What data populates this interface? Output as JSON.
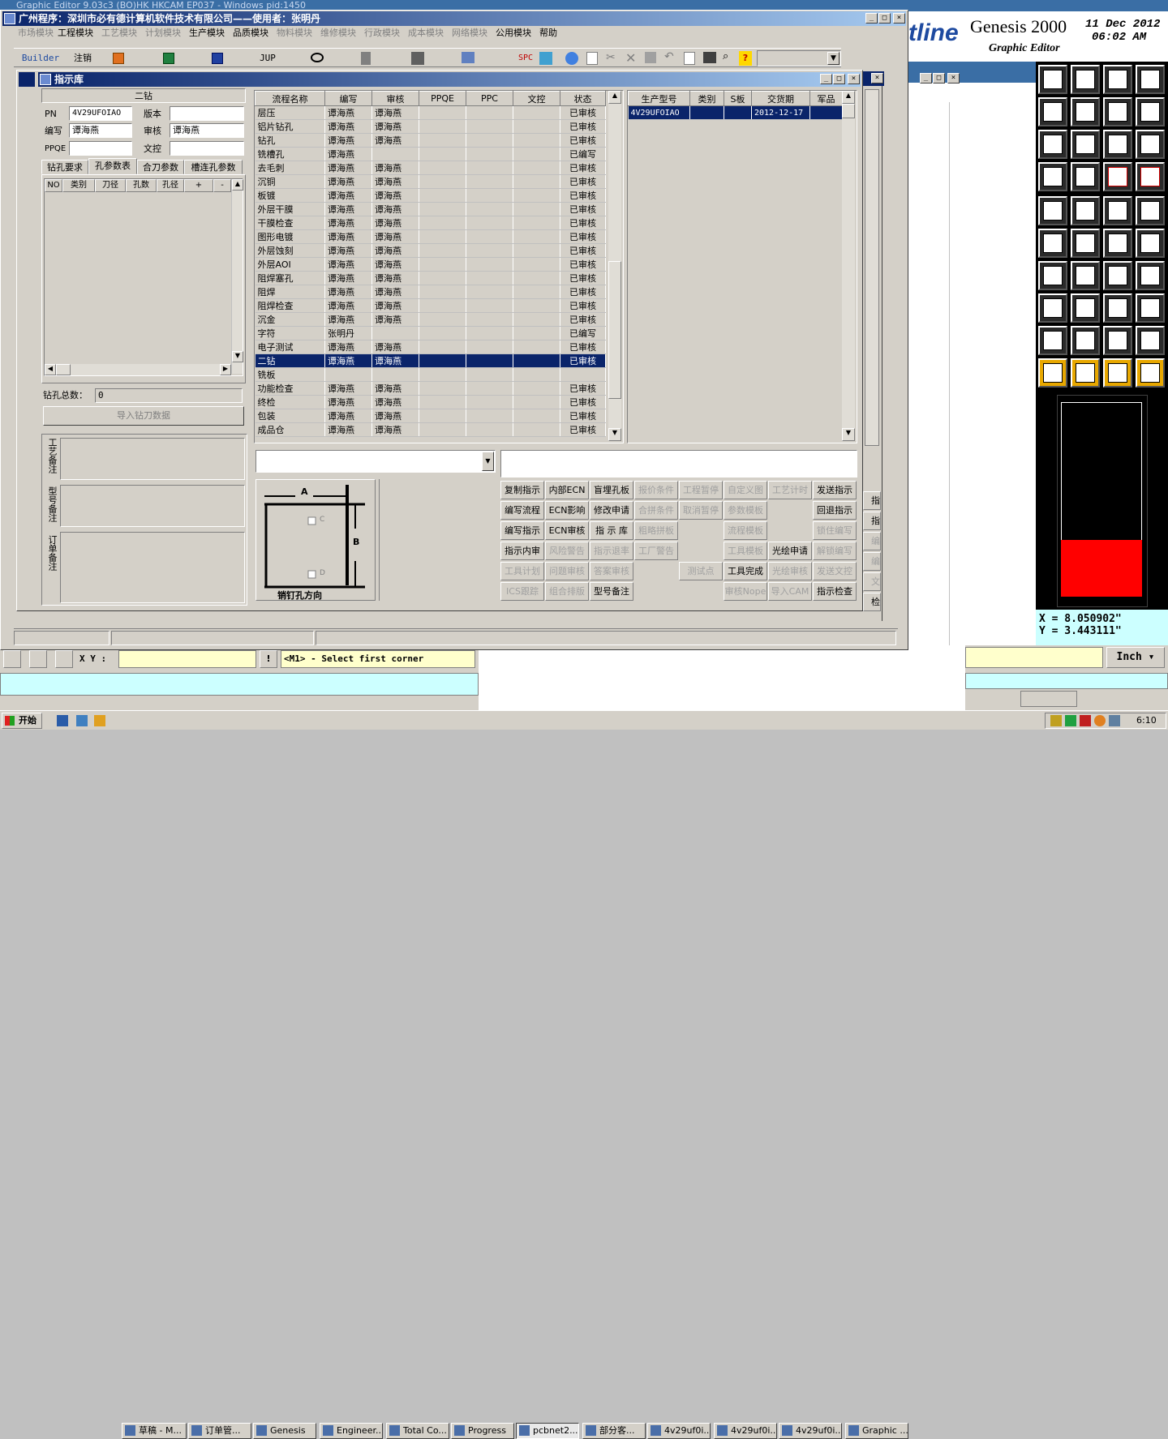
{
  "ge": {
    "title_partial": "Graphic Editor 9.03c3 (BO)HK HKCAM EP037 - Windows pid:1450",
    "brand": "Genesis 2000",
    "brand_sub": "Graphic Editor",
    "logo_fragment": "tline",
    "date": "11 Dec 2012",
    "time": "06:02 AM",
    "coord_x": "X = 8.050902\"",
    "coord_y": "Y = 3.443111\"",
    "unit_button": "Inch",
    "xy_label": "X Y :",
    "status_msg": "<M1> - Select first corner",
    "colors": {
      "accent": "#0a246a",
      "red": "#ff0000",
      "black": "#000000",
      "cyan": "#ccffff"
    }
  },
  "main": {
    "title": "广州程序：深圳市必有德计算机软件技术有限公司——使用者：张明丹",
    "menu": [
      "市场模块",
      "工程模块",
      "工艺模块",
      "计划模块",
      "生产模块",
      "品质模块",
      "物料模块",
      "维修模块",
      "行政模块",
      "成本模块",
      "网络模块",
      "公用模块",
      "帮助"
    ],
    "toolbar": {
      "builder": "Builder",
      "logout": "注销",
      "jup": "JUP",
      "spc": "SPC"
    }
  },
  "dlg": {
    "title": "指示库",
    "left": {
      "section": "二钻",
      "pn_label": "PN",
      "pn_value": "4V29UFOIAO",
      "version_label": "版本",
      "version_value": "",
      "code_label": "编写",
      "code_value": "谭海燕",
      "review_label": "审核",
      "review_value": "谭海燕",
      "ppqe_label": "PPQE",
      "ppqe_value": "",
      "wenkong_label": "文控",
      "wenkong_value": "",
      "tabs": [
        "钻孔要求",
        "孔参数表",
        "合刀参数",
        "槽连孔参数"
      ],
      "cols": [
        "NO",
        "类别",
        "刀径",
        "孔数",
        "孔径",
        "+",
        "-"
      ],
      "total_label": "钻孔总数：",
      "total_value": "0",
      "import_btn": "导入钻刀数据",
      "notes": [
        "工艺备注",
        "型号备注",
        "订单备注"
      ]
    },
    "process": {
      "cols": [
        "流程名称",
        "编写",
        "审核",
        "PPQE",
        "PPC",
        "文控",
        "状态"
      ],
      "rows": [
        [
          "层压",
          "谭海燕",
          "谭海燕",
          "",
          "",
          "",
          "已审核"
        ],
        [
          "铝片钻孔",
          "谭海燕",
          "谭海燕",
          "",
          "",
          "",
          "已审核"
        ],
        [
          "钻孔",
          "谭海燕",
          "谭海燕",
          "",
          "",
          "",
          "已审核"
        ],
        [
          "铣槽孔",
          "谭海燕",
          "",
          "",
          "",
          "",
          "已编写"
        ],
        [
          "去毛刺",
          "谭海燕",
          "谭海燕",
          "",
          "",
          "",
          "已审核"
        ],
        [
          "沉铜",
          "谭海燕",
          "谭海燕",
          "",
          "",
          "",
          "已审核"
        ],
        [
          "板镀",
          "谭海燕",
          "谭海燕",
          "",
          "",
          "",
          "已审核"
        ],
        [
          "外层干膜",
          "谭海燕",
          "谭海燕",
          "",
          "",
          "",
          "已审核"
        ],
        [
          "干膜检查",
          "谭海燕",
          "谭海燕",
          "",
          "",
          "",
          "已审核"
        ],
        [
          "图形电镀",
          "谭海燕",
          "谭海燕",
          "",
          "",
          "",
          "已审核"
        ],
        [
          "外层蚀刻",
          "谭海燕",
          "谭海燕",
          "",
          "",
          "",
          "已审核"
        ],
        [
          "外层AOI",
          "谭海燕",
          "谭海燕",
          "",
          "",
          "",
          "已审核"
        ],
        [
          "阻焊塞孔",
          "谭海燕",
          "谭海燕",
          "",
          "",
          "",
          "已审核"
        ],
        [
          "阻焊",
          "谭海燕",
          "谭海燕",
          "",
          "",
          "",
          "已审核"
        ],
        [
          "阻焊检查",
          "谭海燕",
          "谭海燕",
          "",
          "",
          "",
          "已审核"
        ],
        [
          "沉金",
          "谭海燕",
          "谭海燕",
          "",
          "",
          "",
          "已审核"
        ],
        [
          "字符",
          "张明丹",
          "",
          "",
          "",
          "",
          "已编写"
        ],
        [
          "电子测试",
          "谭海燕",
          "谭海燕",
          "",
          "",
          "",
          "已审核"
        ],
        [
          "二钻",
          "谭海燕",
          "谭海燕",
          "",
          "",
          "",
          "已审核"
        ],
        [
          "铣板",
          "",
          "",
          "",
          "",
          "",
          ""
        ],
        [
          "功能检查",
          "谭海燕",
          "谭海燕",
          "",
          "",
          "",
          "已审核"
        ],
        [
          "终检",
          "谭海燕",
          "谭海燕",
          "",
          "",
          "",
          "已审核"
        ],
        [
          "包装",
          "谭海燕",
          "谭海燕",
          "",
          "",
          "",
          "已审核"
        ],
        [
          "成品仓",
          "谭海燕",
          "谭海燕",
          "",
          "",
          "",
          "已审核"
        ]
      ],
      "selected_index": 18
    },
    "orders": {
      "cols": [
        "生产型号",
        "类别",
        "S板",
        "交货期",
        "军品"
      ],
      "rows": [
        [
          "4V29UFOIAO",
          "",
          "",
          "2012-12-17",
          ""
        ]
      ]
    },
    "diagram": {
      "a": "A",
      "b": "B",
      "c": "C",
      "d": "D",
      "caption": "销钉孔方向"
    },
    "buttons": [
      [
        "复制指示",
        "内部ECN",
        "盲埋孔板",
        "报价条件",
        "工程暂停",
        "自定义图",
        "工艺计时",
        "发送指示"
      ],
      [
        "编写流程",
        "ECN影响",
        "修改申请",
        "合拼条件",
        "取消暂停",
        "参数模板",
        "",
        "回退指示"
      ],
      [
        "编写指示",
        "ECN审核",
        "指 示 库",
        "粗略拼板",
        "",
        "流程模板",
        "",
        "锁住编写"
      ],
      [
        "指示内审",
        "风险警告",
        "指示退率",
        "工厂警告",
        "",
        "工具模板",
        "光绘申请",
        "解锁编写"
      ],
      [
        "工具计划",
        "问题审核",
        "答案审核",
        "",
        "测试点",
        "工具完成",
        "光绘审核",
        "发送文控"
      ],
      [
        "ICS跟踪",
        "组合排版",
        "型号备注",
        "",
        "",
        "审核Nope",
        "导入CAM",
        "指示检查"
      ]
    ],
    "enabled": [
      [
        1,
        1,
        1,
        0,
        0,
        0,
        0,
        1
      ],
      [
        1,
        1,
        1,
        0,
        0,
        0,
        0,
        1
      ],
      [
        1,
        1,
        1,
        0,
        0,
        0,
        0,
        0
      ],
      [
        1,
        0,
        0,
        0,
        0,
        0,
        1,
        0
      ],
      [
        0,
        0,
        0,
        0,
        0,
        1,
        0,
        0
      ],
      [
        0,
        0,
        1,
        0,
        0,
        0,
        0,
        1
      ]
    ],
    "right_clip": [
      "指示",
      "指示",
      "编写",
      "编写",
      "文控",
      "检查"
    ]
  },
  "taskbar": {
    "start": "开始",
    "items": [
      "草稿 - M...",
      "订单管...",
      "Genesis",
      "Engineer...",
      "Total Co...",
      "Progress",
      "pcbnet2...",
      "部分客...",
      "4v29uf0i...",
      "4v29uf0i...",
      "4v29uf0i...",
      "Graphic ..."
    ],
    "clock": "6:10"
  }
}
